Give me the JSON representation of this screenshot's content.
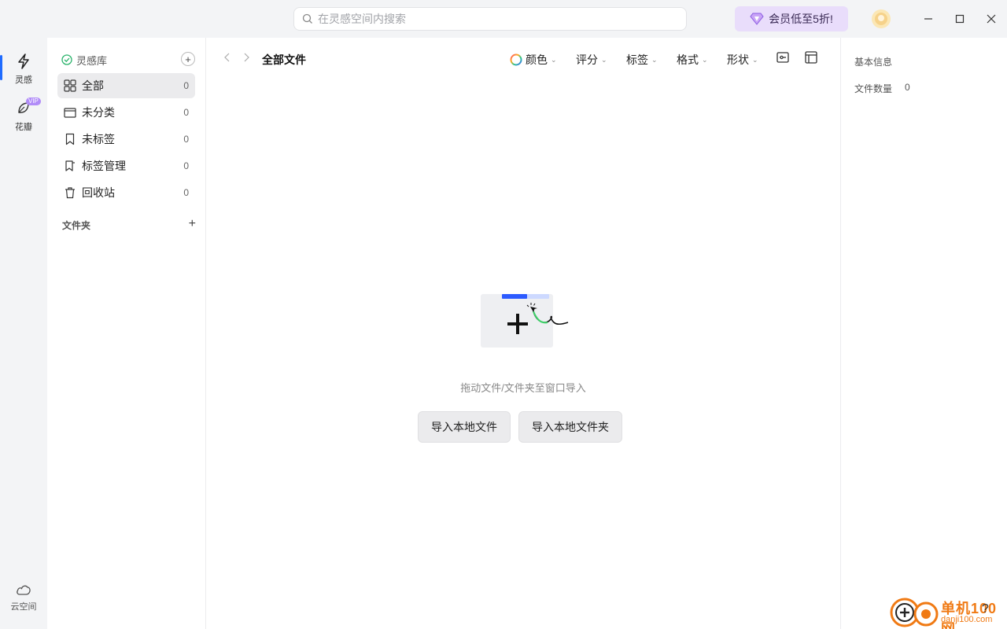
{
  "search": {
    "placeholder": "在灵感空间内搜索"
  },
  "promo": {
    "label": "会员低至5折!"
  },
  "rail": {
    "inspiration": "灵感",
    "petals": "花瓣",
    "petals_badge": "VIP",
    "cloud": "云空间"
  },
  "sidebar": {
    "library_label": "灵感库",
    "items": [
      {
        "label": "全部",
        "count": "0"
      },
      {
        "label": "未分类",
        "count": "0"
      },
      {
        "label": "未标签",
        "count": "0"
      },
      {
        "label": "标签管理",
        "count": "0"
      },
      {
        "label": "回收站",
        "count": "0"
      }
    ],
    "folders_label": "文件夹"
  },
  "main": {
    "title": "全部文件",
    "filters": [
      {
        "label": "颜色"
      },
      {
        "label": "评分"
      },
      {
        "label": "标签"
      },
      {
        "label": "格式"
      },
      {
        "label": "形状"
      }
    ],
    "empty_text": "拖动文件/文件夹至窗口导入",
    "import_file_button": "导入本地文件",
    "import_folder_button": "导入本地文件夹"
  },
  "right_panel": {
    "title": "基本信息",
    "file_count_label": "文件数量",
    "file_count_value": "0"
  },
  "watermark": {
    "site": "单机100网",
    "domain": "danji100.com"
  },
  "colors": {
    "accent": "#1f6bff",
    "promo_bg": "#e9ddfb",
    "vip": "#b18cf8"
  }
}
